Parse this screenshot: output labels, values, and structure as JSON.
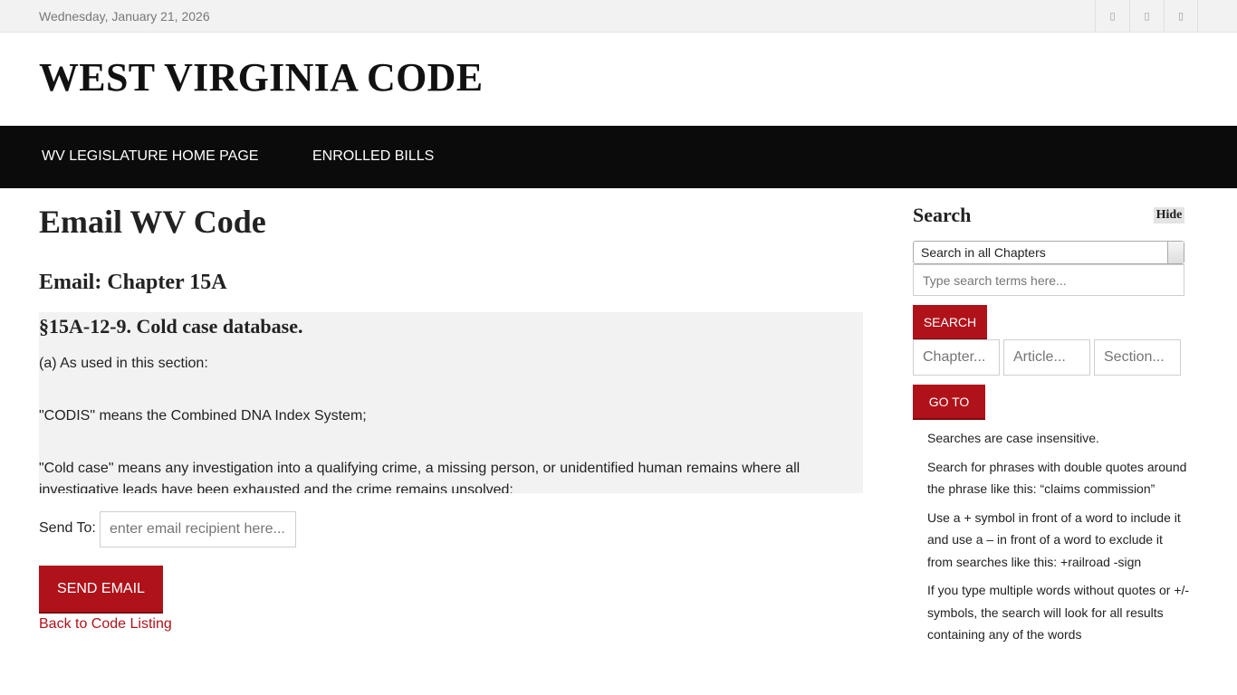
{
  "topbar": {
    "date": "Wednesday, January 21, 2026",
    "icons": [
      {
        "name": "social-icon-1",
        "glyph": "▯"
      },
      {
        "name": "social-icon-2",
        "glyph": "▯"
      },
      {
        "name": "social-icon-3",
        "glyph": "▯"
      }
    ]
  },
  "site": {
    "title": "WEST VIRGINIA CODE"
  },
  "nav": {
    "home": "WV LEGISLATURE HOME PAGE",
    "bills": "ENROLLED BILLS"
  },
  "main": {
    "heading": "Email WV Code",
    "subheading": "Email: Chapter 15A",
    "section_title": "§15A-12-9. Cold case database.",
    "paragraphs": [
      "(a) As used in this section:",
      "\"CODIS\" means the Combined DNA Index System;",
      "\"Cold case\" means any investigation into a qualifying crime, a missing person, or unidentified human remains where all",
      "investigative leads have been exhausted and the crime remains unsolved;"
    ],
    "send_to_label": "Send To:",
    "email_placeholder": "enter email recipient here...",
    "send_button": "SEND EMAIL",
    "back_link": "Back to Code Listing"
  },
  "sidebar": {
    "title": "Search",
    "hide_label": "Hide",
    "scope_selected": "Search in all Chapters",
    "search_placeholder": "Type search terms here...",
    "search_button": "SEARCH",
    "chapter_placeholder": "Chapter...",
    "article_placeholder": "Article...",
    "section_placeholder": "Section...",
    "goto_button": "GO TO",
    "tips": [
      "Searches are case insensitive.",
      "Search for phrases with double quotes around the phrase like this: “claims commission”",
      "Use a + symbol in front of a word to include it and use a – in front of a word to exclude it from searches like this: +railroad -sign",
      "If you type multiple words without quotes or +/- symbols, the search will look for all results containing any of the words"
    ]
  },
  "colors": {
    "accent": "#b0121a",
    "navbar": "#0b0b0b",
    "topbar": "#f2f2f2"
  }
}
